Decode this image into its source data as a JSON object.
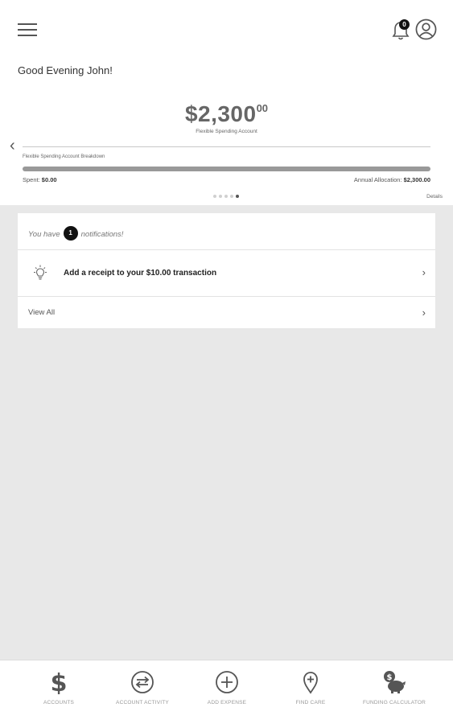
{
  "header": {
    "notification_badge": "0"
  },
  "greeting": "Good Evening John!",
  "balance": {
    "dollars": "$2,300",
    "cents": "00",
    "label": "Flexible Spending Account"
  },
  "breakdown": {
    "label": "Flexible Spending Account Breakdown",
    "spent_label": "Spent:",
    "spent_value": "$0.00",
    "allocation_label": "Annual Allocation:",
    "allocation_value": "$2,300.00",
    "progress_fraction": 1.0
  },
  "carousel": {
    "page_count": 5,
    "active_index": 4,
    "details_label": "Details"
  },
  "notifications": {
    "prefix": "You have",
    "count": "1",
    "suffix": "notifications!",
    "items": [
      {
        "icon": "lightbulb-icon",
        "text": "Add a receipt to your $10.00 transaction"
      }
    ],
    "view_all": "View All"
  },
  "bottom_nav": [
    {
      "icon": "dollar-icon",
      "label": "ACCOUNTS"
    },
    {
      "icon": "exchange-icon",
      "label": "ACCOUNT ACTIVITY"
    },
    {
      "icon": "plus-circle-icon",
      "label": "ADD EXPENSE"
    },
    {
      "icon": "map-pin-plus-icon",
      "label": "FIND CARE"
    },
    {
      "icon": "piggy-bank-icon",
      "label": "FUNDING CALCULATOR"
    }
  ],
  "colors": {
    "background": "#e8e8e8",
    "surface": "#ffffff",
    "text": "#222222",
    "muted": "#999999",
    "badge": "#111111"
  }
}
